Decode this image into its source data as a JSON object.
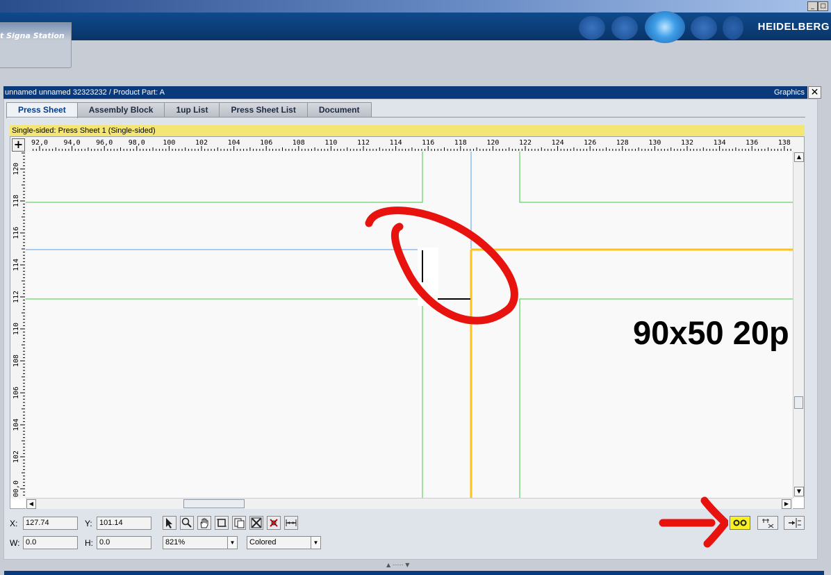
{
  "app": {
    "name": "t Signa Station",
    "logo": "HEIDELBERG",
    "window_buttons": [
      "_",
      "□"
    ]
  },
  "panel": {
    "title": "unnamed unnamed 32323232 / Product Part: A",
    "right_label": "Graphics",
    "close_label": "✕"
  },
  "tabs": [
    {
      "label": "Press Sheet",
      "active": true
    },
    {
      "label": "Assembly Block",
      "active": false
    },
    {
      "label": "1up List",
      "active": false
    },
    {
      "label": "Press Sheet List",
      "active": false
    },
    {
      "label": "Document",
      "active": false
    }
  ],
  "infobar": {
    "text": "Single-sided:  Press Sheet 1 (Single-sided)"
  },
  "ruler": {
    "corner": "+",
    "h_labels": [
      "92,0",
      "94,0",
      "96,0",
      "98,0",
      "100",
      "102",
      "104",
      "106",
      "108",
      "110",
      "112",
      "114",
      "116",
      "118",
      "120",
      "122",
      "124",
      "126",
      "128",
      "130",
      "132",
      "134",
      "136",
      "138"
    ],
    "v_labels": [
      "120",
      "118",
      "116",
      "114",
      "112",
      "110",
      "108",
      "106",
      "104",
      "102",
      "00,0"
    ]
  },
  "canvas": {
    "big_text": "90x50 20p",
    "colors": {
      "trim_lines": "#3ecb3e",
      "bleed_lines": "#ffc21a",
      "guide_lines": "#a8cdf0",
      "annotation": "#e8120e"
    }
  },
  "toolbar": {
    "x_label": "X:",
    "x_value": "127.74",
    "y_label": "Y:",
    "y_value": "101.14",
    "w_label": "W:",
    "w_value": "0.0",
    "h_label": "H:",
    "h_value": "0.0",
    "zoom_value": "821%",
    "color_mode": "Colored",
    "tools": [
      "select-arrow-icon",
      "zoom-icon",
      "hand-pan-icon",
      "crop-icon",
      "copy-page-icon",
      "fit-icon",
      "delete-mark-icon",
      "measure-icon"
    ],
    "right_tools": [
      "settings-gears-icon",
      "step-repeat-icon",
      "align-icon"
    ]
  }
}
